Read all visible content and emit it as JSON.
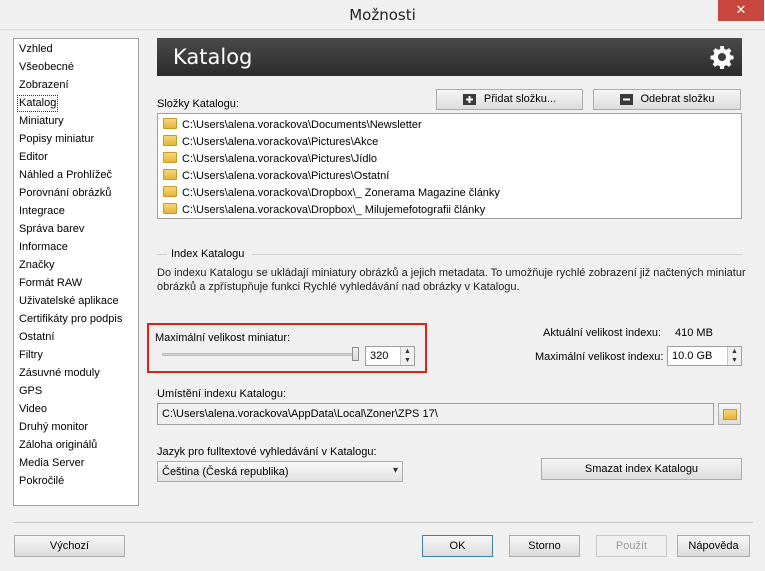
{
  "window": {
    "title": "Možnosti",
    "close_label": "✕"
  },
  "sidebar": {
    "items": [
      "Vzhled",
      "Všeobecné",
      "Zobrazení",
      "Katalog",
      "Miniatury",
      "Popisy miniatur",
      "Editor",
      "Náhled a Prohlížeč",
      "Porovnání obrázků",
      "Integrace",
      "Správa barev",
      "Informace",
      "Značky",
      "Formát RAW",
      "Uživatelské aplikace",
      "Certifikáty pro podpis",
      "Ostatní",
      "Filtry",
      "Zásuvné moduly",
      "GPS",
      "Video",
      "Druhý monitor",
      "Záloha originálů",
      "Media Server",
      "Pokročilé"
    ],
    "selected": "Katalog"
  },
  "header": {
    "title": "Katalog",
    "icon": "gear-icon"
  },
  "folders": {
    "label": "Složky Katalogu:",
    "add_button": "Přidat složku...",
    "remove_button": "Odebrat složku",
    "items": [
      "C:\\Users\\alena.vorackova\\Documents\\Newsletter",
      "C:\\Users\\alena.vorackova\\Pictures\\Akce",
      "C:\\Users\\alena.vorackova\\Pictures\\Jídlo",
      "C:\\Users\\alena.vorackova\\Pictures\\Ostatní",
      "C:\\Users\\alena.vorackova\\Dropbox\\_ Zonerama Magazine články",
      "C:\\Users\\alena.vorackova\\Dropbox\\_ Milujemefotografii články"
    ]
  },
  "index": {
    "group_title": "Index Katalogu",
    "description": "Do indexu Katalogu se ukládají miniatury obrázků a jejich metadata. To umožňuje rychlé zobrazení již načtených miniatur obrázků a zpřístupňuje funkci Rychlé vyhledávání nad obrázky v Katalogu.",
    "max_thumb_label": "Maximální velikost miniatur:",
    "max_thumb_value": "320",
    "slider_fraction": 1.0,
    "current_size_label": "Aktuální velikost indexu:",
    "current_size_value": "410 MB",
    "max_size_label": "Maximální velikost indexu:",
    "max_size_value": "10.0 GB",
    "location_label": "Umístění indexu Katalogu:",
    "location_value": "C:\\Users\\alena.vorackova\\AppData\\Local\\Zoner\\ZPS 17\\",
    "language_label": "Jazyk pro fulltextové vyhledávání v Katalogu:",
    "language_value": "Čeština (Česká republika)",
    "delete_button": "Smazat index Katalogu"
  },
  "footer": {
    "default_button": "Výchozí",
    "ok_button": "OK",
    "cancel_button": "Storno",
    "apply_button": "Použít",
    "help_button": "Nápověda"
  },
  "colors": {
    "highlight": "#e02020",
    "header": "#2f2f2f",
    "close": "#c7463d"
  }
}
